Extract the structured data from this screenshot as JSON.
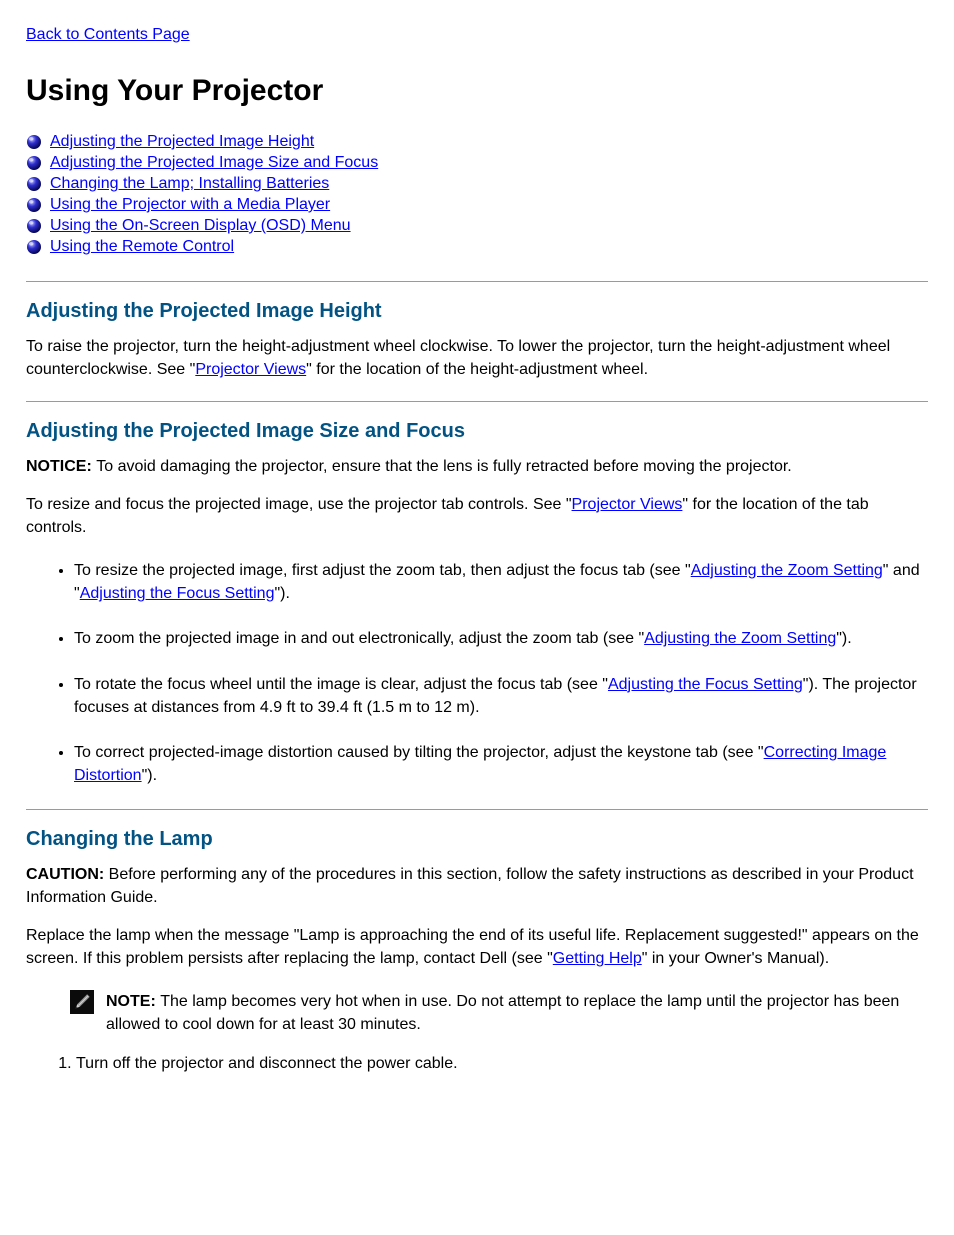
{
  "back_link": "Back to Contents Page",
  "title": "Using Your Projector",
  "toc": [
    "Adjusting the Projected Image Height",
    "Adjusting the Projected Image Size and Focus",
    "Changing the Lamp; Installing Batteries",
    "Using the Projector with a Media Player",
    "Using the On-Screen Display (OSD) Menu",
    "Using the Remote Control"
  ],
  "sec1": {
    "heading": "Adjusting the Projected Image Height",
    "body_pre": "To raise the projector, turn the height-adjustment wheel clockwise. To lower the projector, turn the height-adjustment wheel counterclockwise. See \"",
    "body_link": "Projector Views",
    "body_post": "\" for the location of the height-adjustment wheel."
  },
  "sec2": {
    "heading": "Adjusting the Projected Image Size and Focus",
    "notice_pre": "NOTICE: ",
    "notice_body": "To avoid damaging the projector, ensure that the lens is fully retracted before moving the projector.",
    "intro_pre": "To resize and focus the projected image, use the projector tab controls. See \"",
    "intro_link": "Projector Views",
    "intro_post": "\" for the location of the tab controls.",
    "items": [
      {
        "pre": "To resize the projected image, first adjust the zoom tab, then adjust the focus tab (see \"",
        "link": "Adjusting the Zoom Setting",
        "mid": "\" and \"",
        "link2": "Adjusting the Focus Setting",
        "post": "\")."
      },
      {
        "pre": "To zoom the projected image in and out electronically, adjust the zoom tab (see \"",
        "link": "Adjusting the Zoom Setting",
        "post": "\")."
      },
      {
        "pre": "To rotate the focus wheel until the image is clear, adjust the focus tab (see \"",
        "link": "Adjusting the Focus Setting",
        "post": "\"). The projector focuses at distances from 4.9 ft to 39.4 ft (1.5 m to 12 m)."
      },
      {
        "pre": "To correct projected-image distortion caused by tilting the projector, adjust the keystone tab (see \"",
        "link": "Correcting Image Distortion",
        "post": "\")."
      }
    ]
  },
  "sec3": {
    "heading": "Changing the Lamp",
    "caution_pre": "CAUTION: ",
    "caution_body": "Before performing any of the procedures in this section, follow the safety instructions as described in your Product Information Guide.",
    "body_pre": "Replace the lamp when the message \"Lamp is approaching the end of its useful life. Replacement suggested!\" appears on the screen. If this problem persists after replacing the lamp, contact Dell (see \"",
    "body_link": "Getting Help",
    "body_post": "\" in your Owner's Manual).",
    "note_caption": "NOTE: ",
    "note_body": "The lamp becomes very hot when in use. Do not attempt to replace the lamp until the projector has been allowed to cool down for at least 30 minutes.",
    "steps": [
      "Turn off the projector and disconnect the power cable."
    ]
  }
}
